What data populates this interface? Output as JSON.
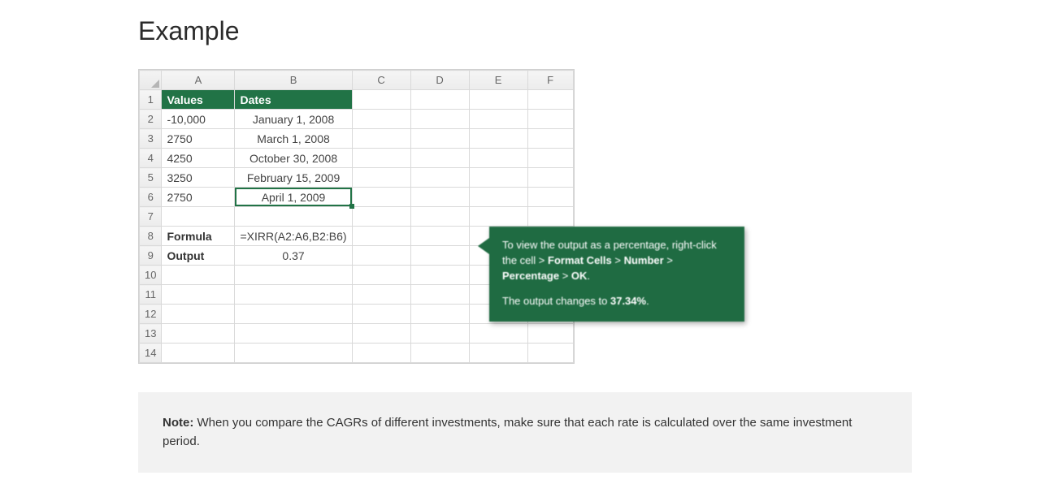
{
  "heading": "Example",
  "columns": [
    "A",
    "B",
    "C",
    "D",
    "E",
    "F"
  ],
  "row_numbers": [
    "1",
    "2",
    "3",
    "4",
    "5",
    "6",
    "7",
    "8",
    "9",
    "10",
    "11",
    "12",
    "13",
    "14"
  ],
  "rows": {
    "r1": {
      "A": "Values",
      "B": "Dates"
    },
    "r2": {
      "A": "-10,000",
      "B": "January 1, 2008"
    },
    "r3": {
      "A": "2750",
      "B": "March 1, 2008"
    },
    "r4": {
      "A": "4250",
      "B": "October 30, 2008"
    },
    "r5": {
      "A": "3250",
      "B": "February 15, 2009"
    },
    "r6": {
      "A": "2750",
      "B": "April 1, 2009"
    },
    "r8": {
      "A": "Formula",
      "B": "=XIRR(A2:A6,B2:B6)"
    },
    "r9": {
      "A": "Output",
      "B": "0.37"
    }
  },
  "callout": {
    "line1_a": "To view the output as a percentage, right-click the cell > ",
    "line1_b_bold": "Format Cells",
    "line1_c": " > ",
    "line1_d_bold": "Number",
    "line1_e": " > ",
    "line1_f_bold": "Percentage",
    "line1_g": " > ",
    "line1_h_bold": "OK",
    "line1_i": ".",
    "line2_a": "The output changes to ",
    "line2_b_bold": "37.34%",
    "line2_c": "."
  },
  "note": {
    "label": "Note:",
    "text": " When you compare the CAGRs of different investments, make sure that each rate is calculated over the same investment period."
  }
}
